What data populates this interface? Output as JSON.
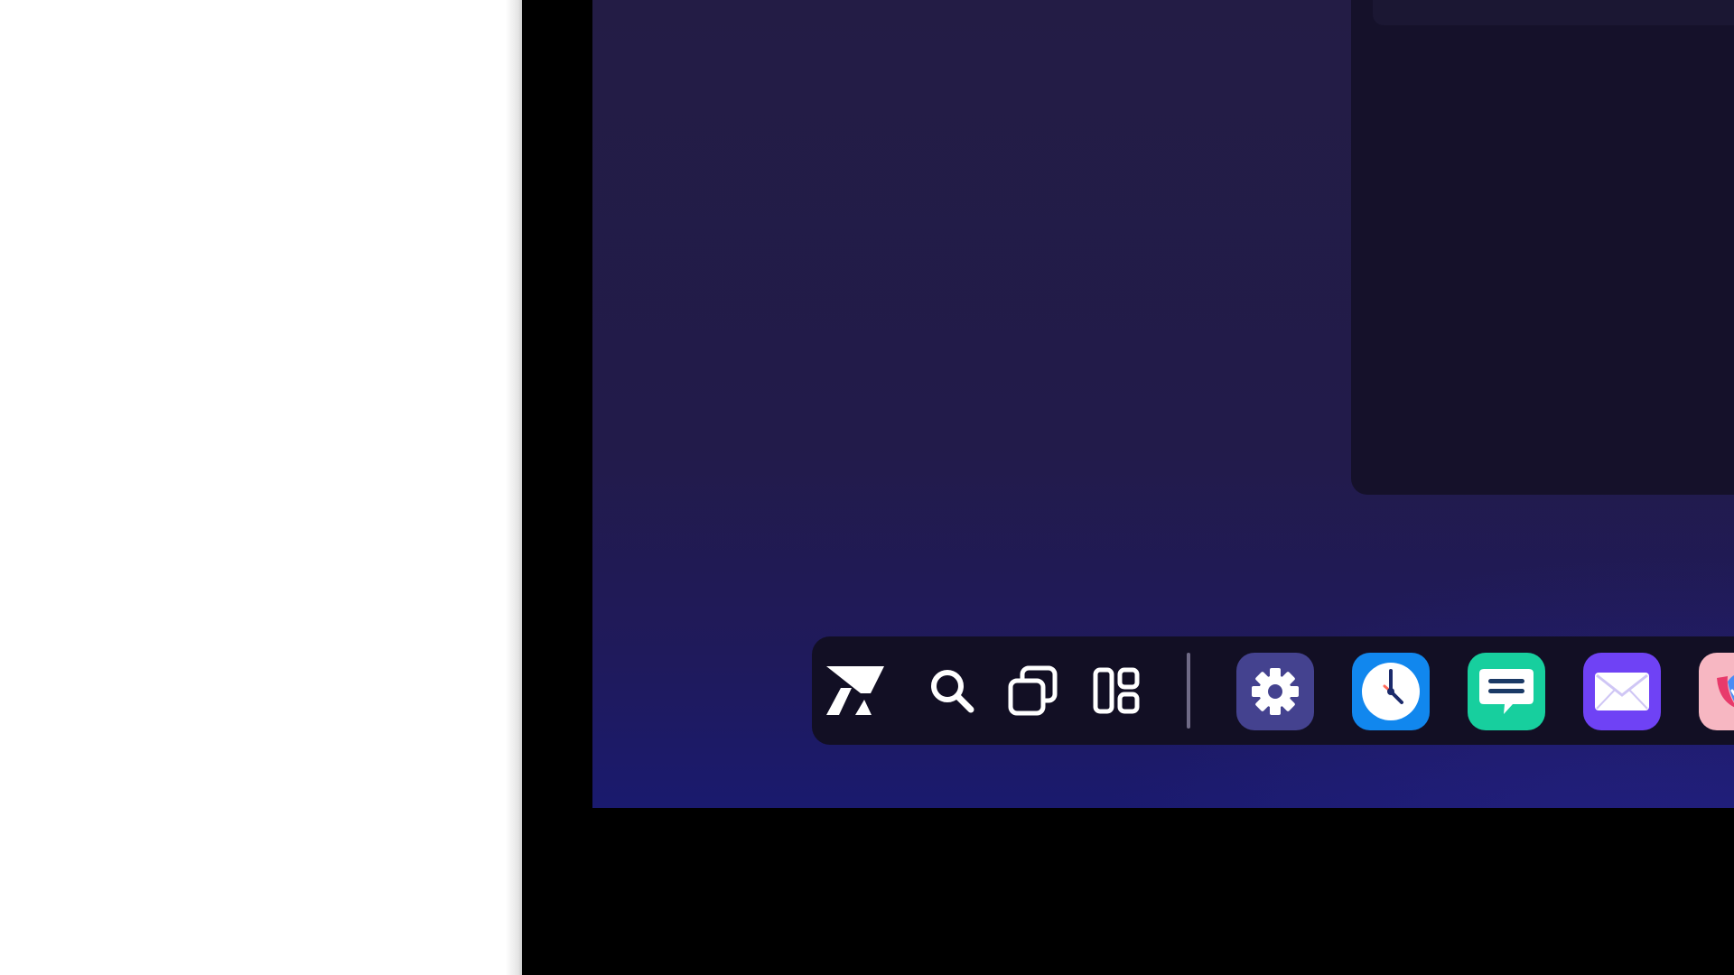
{
  "colors": {
    "desktop_top": "#231c45",
    "desktop_bottom": "#1a1a6e",
    "taskbar_bg": "#120f24",
    "window_bg": "#15112a",
    "settings_tile": "#44428f",
    "clock_tile": "#1187ee",
    "chat_tile": "#17cf9e",
    "mail_tile": "#6f42f5",
    "tulip_tile": "#f7b7c2"
  },
  "taskbar": {
    "system_buttons": [
      {
        "icon": "launcher-logo-icon"
      },
      {
        "icon": "search-icon"
      },
      {
        "icon": "window-switcher-icon"
      },
      {
        "icon": "widgets-layout-icon"
      }
    ],
    "pinned_apps": [
      {
        "icon": "gear-icon"
      },
      {
        "icon": "clock-icon"
      },
      {
        "icon": "chat-bubble-icon"
      },
      {
        "icon": "envelope-icon"
      },
      {
        "icon": "tulip-icon"
      }
    ]
  }
}
